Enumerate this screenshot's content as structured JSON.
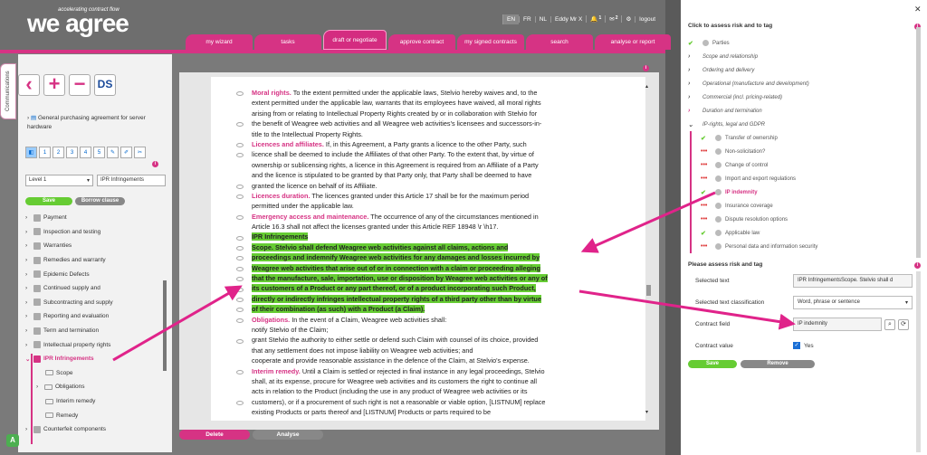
{
  "logo": {
    "brand": "we agree",
    "tagline": "accelerating contract flow"
  },
  "topbar": {
    "langs": [
      "EN",
      "FR",
      "NL"
    ],
    "user": "Eddy Mr X",
    "bell_count": "1",
    "mail_count": "2",
    "logout": "logout"
  },
  "nav": [
    "my wizard",
    "tasks",
    "draft or negotiate",
    "approve contract",
    "my signed contracts",
    "search",
    "analyse or report"
  ],
  "sidetab": "Communications",
  "left": {
    "doc_title": "General purchasing agreement for server hardware",
    "levels": [
      "1",
      "2",
      "3",
      "4",
      "5"
    ],
    "level_select": "Level 1",
    "search_value": "IPR Infringements",
    "save": "Save",
    "borrow": "Borrow clause",
    "tree": [
      {
        "label": "Payment"
      },
      {
        "label": "Inspection and testing"
      },
      {
        "label": "Warranties"
      },
      {
        "label": "Remedies and warranty"
      },
      {
        "label": "Epidemic Defects"
      },
      {
        "label": "Continued supply and"
      },
      {
        "label": "Subcontracting and supply"
      },
      {
        "label": "Reporting and evaluation"
      },
      {
        "label": "Term and termination"
      },
      {
        "label": "Intellectual property rights"
      },
      {
        "label": "IPR Infringements"
      }
    ],
    "subtree": [
      "Scope",
      "Obligations",
      "Interim remedy",
      "Remedy"
    ],
    "tree_last": "Counterfeit components"
  },
  "doc": {
    "lines": [
      {
        "h": "Moral rights.",
        "t": " To the extent permitted under the applicable laws, Stelvio hereby waives and, to the"
      },
      {
        "t": "extent permitted under the applicable law, warrants that its employees have waived, all moral rights"
      },
      {
        "t": "arising from or relating to Intellectual Property Rights created by or in collaboration with Stelvio for"
      },
      {
        "t": "the benefit of Weagree web activities and all Weagree web activities's licensees and successors-in-"
      },
      {
        "t": "title to the Intellectual Property Rights."
      },
      {
        "h": "Licences and affiliates.",
        "t": " If, in this Agreement, a Party grants a licence to the other Party, such"
      },
      {
        "t": "licence shall be deemed to include the Affiliates of that other Party. To the extent that, by virtue of"
      },
      {
        "t": "ownership or sublicensing rights, a licence in this Agreement is required from an Affiliate of a Party"
      },
      {
        "t": "and the licence is stipulated to be granted by that Party only, that Party shall be deemed to have"
      },
      {
        "t": "granted the licence on behalf of its Affiliate."
      },
      {
        "h": "Licences duration.",
        "t": " The licences granted under this Article 17 shall be for the maximum period"
      },
      {
        "t": "permitted under the applicable law."
      },
      {
        "h": "Emergency access and maintenance.",
        "t": " The occurrence of any of the circumstances mentioned in"
      },
      {
        "t": "Article 16.3 shall not affect the licenses granted under this Article REF 18948 \\r \\h17."
      },
      {
        "hl": "IPR Infringements"
      },
      {
        "hl": "Scope. Stelvio shall defend Weagree web activities against all claims, actions and"
      },
      {
        "hl": "proceedings and indemnify Weagree web activities for any damages and losses incurred by"
      },
      {
        "hl": "Weagree web activities that arise out of or in connection with a claim or proceeding alleging"
      },
      {
        "hl": "that the manufacture, sale, importation, use or disposition by Weagree web activities or any of"
      },
      {
        "hl": "its customers of a Product or any part thereof, or of a product incorporating such Product,"
      },
      {
        "hl": "directly or indirectly infringes intellectual property rights of a third party other than by virtue"
      },
      {
        "hl": "of their combination (as such) with a Product (a Claim)."
      },
      {
        "h": "Obligations.",
        "t": " In the event of a Claim, Weagree web activities shall:"
      },
      {
        "t": "notify Stelvio of the Claim;"
      },
      {
        "t": "grant Stelvio the authority to either settle or defend such Claim with counsel of its choice, provided"
      },
      {
        "t": "that any settlement does not impose liability on Weagree web activities; and"
      },
      {
        "t": "cooperate and provide reasonable assistance in the defence of the Claim, at Stelvio's expense."
      },
      {
        "h": "Interim remedy.",
        "t": " Until a Claim is settled or rejected in final instance in any legal proceedings, Stelvio"
      },
      {
        "t": "shall, at its expense, procure for Weagree web activities and its customers the right to continue all"
      },
      {
        "t": "acts in relation to the Product (including the use in any product of Weagree web activities or its"
      },
      {
        "t": "customers), or if a procurement of such right is not a reasonable or viable option, [LISTNUM] replace"
      },
      {
        "t": "existing Products or parts thereof and [LISTNUM] Products or parts required to be"
      }
    ],
    "delete": "Delete",
    "analyse": "Analyse"
  },
  "right": {
    "title": "Click to assess risk and to tag",
    "items": [
      {
        "mk": "✔",
        "cls": "g",
        "label": "Parties",
        "type": "top"
      },
      {
        "mk": "›",
        "cls": "",
        "label": "Scope and relationship",
        "type": "cat"
      },
      {
        "mk": "›",
        "cls": "",
        "label": "Ordering and delivery",
        "type": "cat"
      },
      {
        "mk": "›",
        "cls": "",
        "label": "Operational (manufacture and development)",
        "type": "cat"
      },
      {
        "mk": "›",
        "cls": "",
        "label": "Commercial (incl. pricing-related)",
        "type": "cat"
      },
      {
        "mk": "›",
        "cls": "warn",
        "label": "Duration and termination",
        "type": "cat"
      },
      {
        "mk": "⌄",
        "cls": "",
        "label": "IP-rights, legal and GDPR",
        "type": "cat"
      },
      {
        "mk": "✔",
        "cls": "g",
        "label": "Transfer of ownership",
        "type": "sub"
      },
      {
        "mk": "•••",
        "cls": "r",
        "label": "Non-solicitation?",
        "type": "sub"
      },
      {
        "mk": "•••",
        "cls": "r",
        "label": "Change of control",
        "type": "sub"
      },
      {
        "mk": "•••",
        "cls": "r",
        "label": "Import and export regulations",
        "type": "sub"
      },
      {
        "mk": "✔",
        "cls": "g",
        "label": "IP indemnity",
        "type": "sub active"
      },
      {
        "mk": "•••",
        "cls": "r",
        "label": "Insurance coverage",
        "type": "sub"
      },
      {
        "mk": "•••",
        "cls": "r",
        "label": "Dispute resolution options",
        "type": "sub"
      },
      {
        "mk": "✔",
        "cls": "g",
        "label": "Applicable law",
        "type": "sub"
      },
      {
        "mk": "•••",
        "cls": "r",
        "label": "Personal data and information security",
        "type": "sub"
      }
    ],
    "assess_title": "Please assess risk and tag",
    "fields": {
      "sel_text_label": "Selected text",
      "sel_text": "IPR InfringementsScope. Stelvio shall d",
      "class_label": "Selected text classification",
      "class_value": "Word, phrase or sentence",
      "contract_label": "Contract field",
      "contract_value": "IP indemnity",
      "value_label": "Contract value",
      "value": "Yes"
    },
    "save": "Save",
    "remove": "Remove"
  },
  "colors": {
    "accent": "#d63384",
    "green": "#66cc33"
  }
}
